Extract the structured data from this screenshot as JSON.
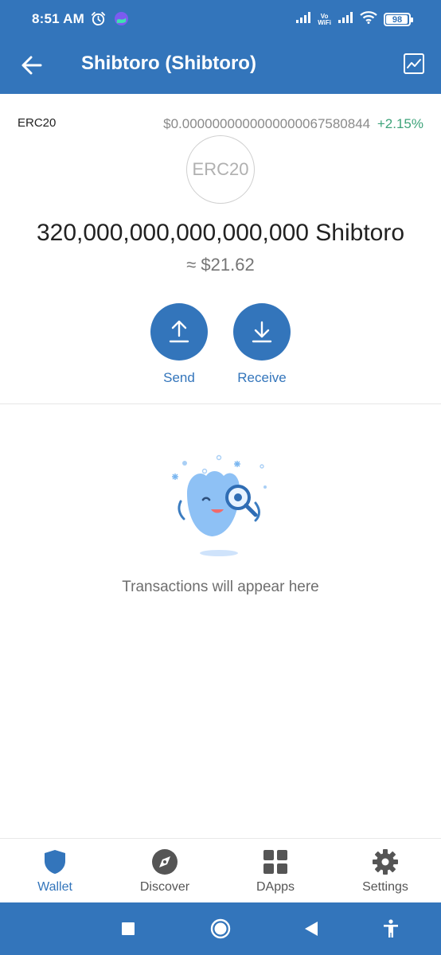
{
  "status_bar": {
    "time": "8:51 AM",
    "vowifi_line1": "Vo",
    "vowifi_line2": "WiFi",
    "battery": "98",
    "battery_level": 0.98,
    "icons": [
      "alarm-icon",
      "app-notification-icon",
      "signal-icon",
      "vowifi-icon",
      "signal-icon",
      "wifi-icon",
      "battery-icon"
    ]
  },
  "app_bar": {
    "title": "Shibtoro (Shibtoro)",
    "back_icon": "arrow-left-icon",
    "chart_icon": "chart-icon"
  },
  "token": {
    "network": "ERC20",
    "price": "$0.0000000000000000067580844",
    "change": "+2.15%",
    "change_color": "#3ea37a",
    "logo_text": "ERC20",
    "balance": "320,000,000,000,000,000 Shibtoro",
    "fiat_value": "≈ $21.62"
  },
  "actions": {
    "send_label": "Send",
    "receive_label": "Receive"
  },
  "transactions": {
    "empty_message": "Transactions will appear here"
  },
  "bottom_nav": {
    "items": [
      {
        "label": "Wallet",
        "icon": "shield-icon",
        "active": true
      },
      {
        "label": "Discover",
        "icon": "compass-icon",
        "active": false
      },
      {
        "label": "DApps",
        "icon": "grid-icon",
        "active": false
      },
      {
        "label": "Settings",
        "icon": "gear-icon",
        "active": false
      }
    ]
  },
  "colors": {
    "primary": "#3375bb",
    "positive": "#3ea37a"
  }
}
